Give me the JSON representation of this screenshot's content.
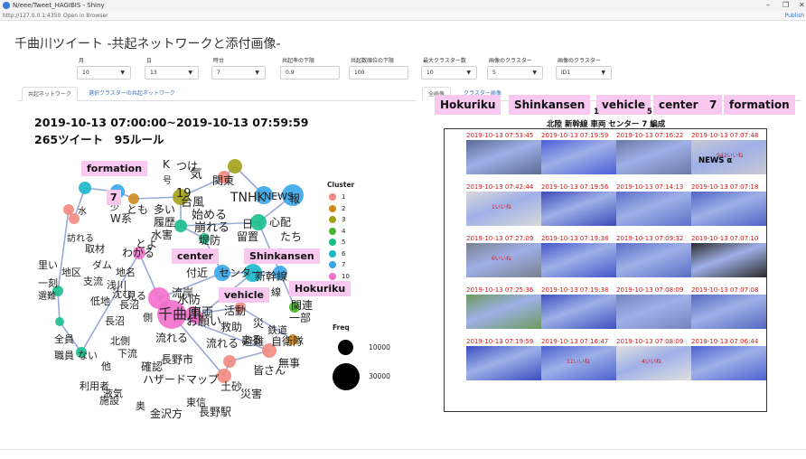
{
  "window": {
    "title": "N/eee/Tweet_HAGIBIS - Shiny",
    "address": "http://127.0.0.1:4350",
    "open_in_browser": "Open in Browser",
    "publish": "Publish",
    "controls": [
      "–",
      "❐",
      "✕"
    ]
  },
  "app": {
    "title": "千曲川ツイート -共起ネットワークと添付画像-"
  },
  "filters": [
    {
      "label": "月",
      "value": "10"
    },
    {
      "label": "日",
      "value": "13"
    },
    {
      "label": "時台",
      "value": "7"
    },
    {
      "label": "共起率の下限",
      "value": "0.9"
    },
    {
      "label": "共起数順位の下限",
      "value": "100"
    },
    {
      "label": "最大クラスター数",
      "value": "10"
    },
    {
      "label": "画像のクラスター",
      "value": "5"
    },
    {
      "label": "画像のクラスター",
      "value": "ID1"
    }
  ],
  "left_tabs": [
    "共起ネットワーク",
    "選択クラスターの共起ネットワーク"
  ],
  "right_tabs": [
    "全画像",
    "クラスター画像"
  ],
  "network": {
    "heading": "2019-10-13 07:00:00~2019-10-13 07:59:59",
    "subheading": "265ツイート　95ルール",
    "legend_title": "Cluster",
    "clusters": [
      {
        "label": "1",
        "color": "#f28a7f"
      },
      {
        "label": "2",
        "color": "#cf8a1f"
      },
      {
        "label": "3",
        "color": "#a3a016"
      },
      {
        "label": "4",
        "color": "#4cb12f"
      },
      {
        "label": "5",
        "color": "#19bd8c"
      },
      {
        "label": "6",
        "color": "#1bb7c9"
      },
      {
        "label": "7",
        "color": "#36a6e8"
      },
      {
        "label": "10",
        "color": "#f36fcc"
      }
    ],
    "freq_title": "Freq",
    "freq": [
      "10000",
      "30000"
    ],
    "words": [
      "K",
      "つけ",
      "気",
      "関東",
      "TNHK",
      "NEWS",
      "報",
      "号",
      "19",
      "台風",
      "始める",
      "崩れる",
      "多い",
      "少",
      "とも",
      "W系",
      "履歴",
      "水害",
      "心配",
      "日",
      "留置",
      "たち",
      "水",
      "訪れる",
      "とよ",
      "取材",
      "わかる",
      "堤防",
      "里い",
      "地区",
      "支流",
      "ダム",
      "地名",
      "付近",
      "センター",
      "新幹線",
      "一刻",
      "浅川",
      "沈む",
      "見る",
      "流岸",
      "線",
      "選難",
      "低地",
      "長沼",
      "水防",
      "千曲川",
      "車両",
      "関連",
      "お願い",
      "活動",
      "一部",
      "災",
      "長沼",
      "側",
      "流れる",
      "救助",
      "鉄道",
      "避難",
      "全員",
      "北側",
      "下流",
      "流れる",
      "まる",
      "自衛隊",
      "職員",
      "ない",
      "他",
      "確認",
      "長野市",
      "無事",
      "皆さん",
      "利用者",
      "液気",
      "ハザードマップ",
      "土砂",
      "災害",
      "施設",
      "東信",
      "奥",
      "金沢方",
      "長野駅"
    ]
  },
  "labels": {
    "formation": "formation",
    "seven": "7",
    "center": "center",
    "shinkansen": "Shinkansen",
    "vehicle": "vehicle",
    "hokuriku": "Hokuriku"
  },
  "right_labels": {
    "hokuriku": "Hokuriku",
    "shinkansen": "Shinkansen",
    "vehicle": "vehicle",
    "center": "center",
    "seven": "7",
    "formation": "formation",
    "num1": "1",
    "num2": "5"
  },
  "plot_title": "北陸 新幹線 車両 センター 7 編成",
  "images": [
    {
      "ts": "2019-10-13 07:53:45",
      "caption": "",
      "news": ""
    },
    {
      "ts": "2019-10-13 07:19:59",
      "caption": "",
      "news": ""
    },
    {
      "ts": "2019-10-13 07:16:22",
      "caption": "",
      "news": ""
    },
    {
      "ts": "2019-10-13 07:07:48",
      "caption": "942いいね",
      "news": "NEWS α"
    },
    {
      "ts": "2019-10-13 07:42:44",
      "caption": "1いいね",
      "news": ""
    },
    {
      "ts": "2019-10-13 07:19:56",
      "caption": "",
      "news": ""
    },
    {
      "ts": "2019-10-13 07:14:13",
      "caption": "",
      "news": ""
    },
    {
      "ts": "2019-10-13 07:07:18",
      "caption": "",
      "news": ""
    },
    {
      "ts": "2019-10-13 07:27:09",
      "caption": "6いいね",
      "news": ""
    },
    {
      "ts": "2019-10-13 07:19:38",
      "caption": "",
      "news": ""
    },
    {
      "ts": "2019-10-13 07:09:32",
      "caption": "",
      "news": ""
    },
    {
      "ts": "2019-10-13 07:07:10",
      "caption": "",
      "news": ""
    },
    {
      "ts": "2019-10-13 07:25:36",
      "caption": "",
      "news": ""
    },
    {
      "ts": "2019-10-13 07:19:38",
      "caption": "",
      "news": ""
    },
    {
      "ts": "2019-10-13 07:08:09",
      "caption": "",
      "news": ""
    },
    {
      "ts": "2019-10-13 07:07:08",
      "caption": "",
      "news": ""
    },
    {
      "ts": "2019-10-13 07:19:59",
      "caption": "",
      "news": ""
    },
    {
      "ts": "2019-10-13 07:16:47",
      "caption": "11いいね",
      "news": ""
    },
    {
      "ts": "2019-10-13 07:08:09",
      "caption": "4いいね",
      "news": ""
    },
    {
      "ts": "2019-10-13 07:06:44",
      "caption": "",
      "news": ""
    }
  ],
  "image_colors": [
    "#5a6a93",
    "#4b5fd6",
    "#6b78a6",
    "#c9c9d4",
    "#d9d9d9",
    "#3b4ab8",
    "#5d6fc8",
    "#4f63c4",
    "#7a7f8f",
    "#4456c9",
    "#5a6cc4",
    "#2a2a2a",
    "#6e9a5d",
    "#3e4fbf",
    "#7583bd",
    "#5768c0",
    "#3a4ec0",
    "#4c62cf",
    "#e0e0e0",
    "#4c62cf"
  ]
}
